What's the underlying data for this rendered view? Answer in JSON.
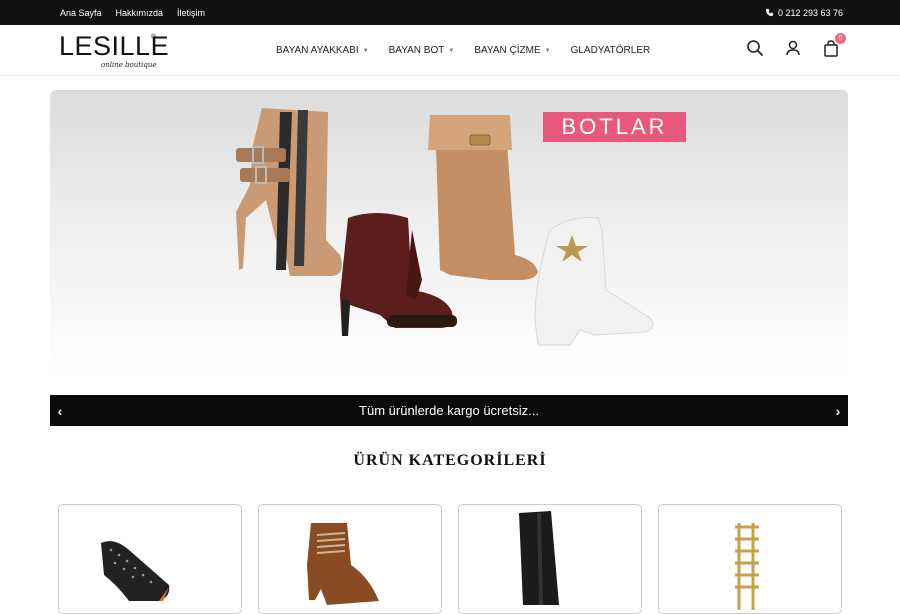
{
  "topbar": {
    "links": [
      "Ana Sayfa",
      "Hakkımızda",
      "İletişim"
    ],
    "phone": "0 212 293 63 76",
    "phone_icon": "phone-icon"
  },
  "header": {
    "logo": {
      "wordmark": "LESILLE",
      "reg": "®",
      "tagline": "online boutique"
    },
    "nav": [
      {
        "label": "BAYAN AYAKKABI",
        "has_dropdown": true
      },
      {
        "label": "BAYAN BOT",
        "has_dropdown": true
      },
      {
        "label": "BAYAN ÇİZME",
        "has_dropdown": true
      },
      {
        "label": "GLADYATÖRLER",
        "has_dropdown": false
      }
    ],
    "icons": [
      "search-icon",
      "user-icon",
      "cart-icon"
    ],
    "cart_count": "0",
    "accent": "#f06a7a"
  },
  "hero": {
    "title": "BOTLAR",
    "title_bg": "#e8597b"
  },
  "announce": {
    "text": "Tüm ürünlerde kargo ücretsiz...",
    "prev": "‹",
    "next": "›"
  },
  "section": {
    "title": "ÜRÜN KATEGORİLERİ"
  },
  "categories": [
    {
      "icon": "studded-pump-image"
    },
    {
      "icon": "brown-ankle-boot-image"
    },
    {
      "icon": "black-tall-boot-image"
    },
    {
      "icon": "gold-gladiator-sandal-image"
    }
  ]
}
